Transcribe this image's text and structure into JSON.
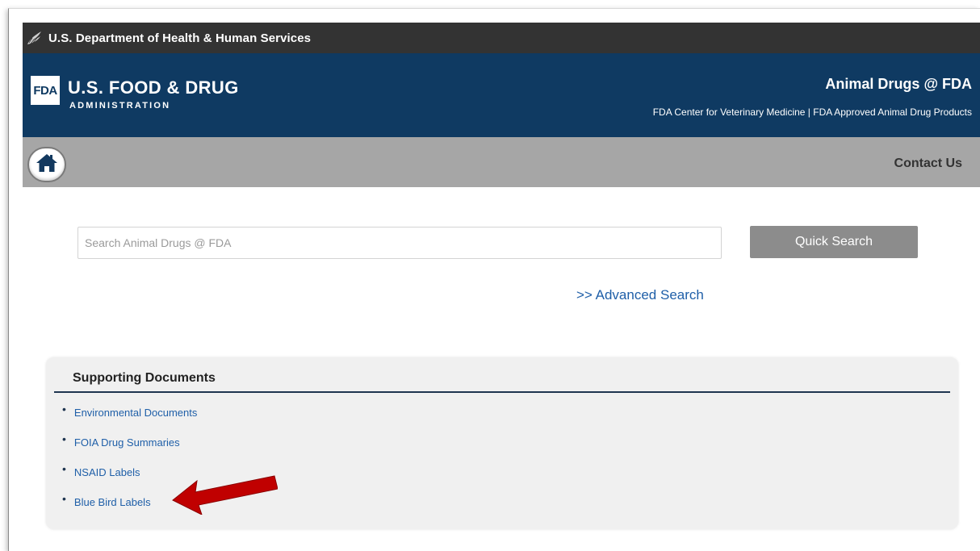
{
  "hhs_bar": {
    "label": "U.S. Department of Health & Human Services"
  },
  "fda_header": {
    "logo_text": "FDA",
    "agency_name": "U.S. FOOD & DRUG",
    "agency_sub": "ADMINISTRATION",
    "site_title": "Animal Drugs @ FDA",
    "site_subtitle": "FDA Center for Veterinary Medicine | FDA Approved Animal Drug Products"
  },
  "nav": {
    "home_icon": "home-icon",
    "contact_label": "Contact Us"
  },
  "search": {
    "placeholder": "Search Animal Drugs @ FDA",
    "value": "",
    "button_label": "Quick Search",
    "advanced_label": ">> Advanced Search"
  },
  "supporting_documents": {
    "title": "Supporting Documents",
    "items": [
      {
        "label": "Environmental Documents"
      },
      {
        "label": "FOIA Drug Summaries"
      },
      {
        "label": "NSAID Labels"
      },
      {
        "label": "Blue Bird Labels"
      }
    ]
  },
  "annotation": {
    "arrow_color": "#c00000",
    "points_to": "Blue Bird Labels"
  },
  "colors": {
    "hhs_bar": "#333333",
    "fda_blue": "#0f3a62",
    "nav_gray": "#a6a6a6",
    "button_gray": "#8c8c8c",
    "link_blue": "#1f5fa8"
  }
}
